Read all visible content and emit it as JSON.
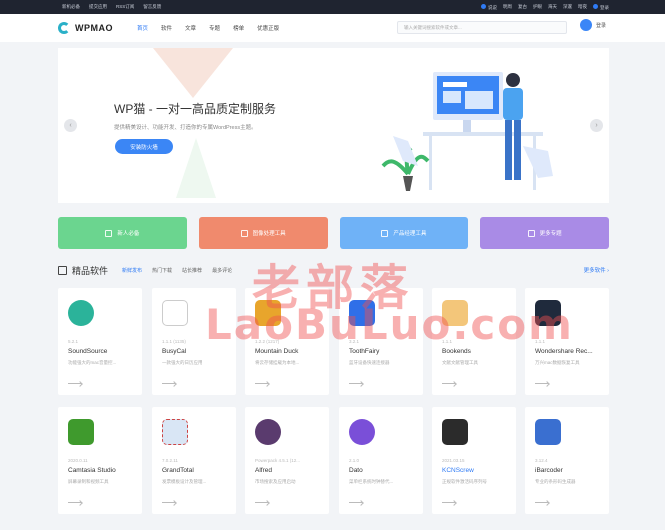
{
  "topbar": {
    "left_links": [
      "新机必备",
      "提交应用",
      "RSS订阅",
      "留言反馈"
    ],
    "right_links": [
      "说说",
      "明周",
      "复古",
      "护眼",
      "海天",
      "深邃",
      "暗夜",
      "登录"
    ]
  },
  "header": {
    "logo": "WPMAO",
    "nav": [
      "首页",
      "软件",
      "文章",
      "专题",
      "榜单",
      "优惠正版"
    ],
    "search_placeholder": "输入关键词搜索软件或文章...",
    "login": "登录"
  },
  "banner": {
    "title": "WP猫 - 一对一高品质定制服务",
    "subtitle": "提供精美设计、功能开发、打造你的专属WordPress主题。",
    "button": "安装防火墙",
    "prev": "‹",
    "next": "›"
  },
  "categories": [
    {
      "label": "新人必备",
      "color": "#6bd58f"
    },
    {
      "label": "图像处理工具",
      "color": "#f08a6d"
    },
    {
      "label": "产品经理工具",
      "color": "#6fb2f7"
    },
    {
      "label": "更多专题",
      "color": "#a98be6"
    }
  ],
  "section": {
    "title": "精品软件",
    "tabs": [
      "新鲜发布",
      "热门下载",
      "站长推荐",
      "最多评论"
    ],
    "more": "更多软件 ›"
  },
  "apps": [
    {
      "version": "5.2.1",
      "name": "SoundSource",
      "desc": "功能强大的mac音量控...",
      "icon_color": "#2bb39a"
    },
    {
      "version": "1.1.1 (1135)",
      "name": "BusyCal",
      "desc": "一款强大的日历应用",
      "icon_color": "#e8e8e8"
    },
    {
      "version": "1.2.2 (1217)",
      "name": "Mountain Duck",
      "desc": "将云存储挂载为本地...",
      "icon_color": "#e8a52c"
    },
    {
      "version": "3.2.1",
      "name": "ToothFairy",
      "desc": "蓝牙设备快速连接器",
      "icon_color": "#2f6fe8"
    },
    {
      "version": "1.1.1",
      "name": "Bookends",
      "desc": "文献文献管理工具",
      "icon_color": "#f3c67a"
    },
    {
      "version": "1.1.1",
      "name": "Wondershare Rec...",
      "desc": "万兴mac数据恢复工具",
      "icon_color": "#1f2a3c"
    },
    {
      "version": "2020.0.11",
      "name": "Camtasia Studio",
      "desc": "屏幕录制和视频工具",
      "icon_color": "#3f9a2d"
    },
    {
      "version": "7.0.2.11",
      "name": "GrandTotal",
      "desc": "发票模板设计及管理...",
      "icon_color": "#d9e6f5"
    },
    {
      "version": "Powerpack 4.5.1 (12...",
      "name": "Alfred",
      "desc": "市场搜索及应用启动",
      "icon_color": "#5a3b6e"
    },
    {
      "version": "2.1.0",
      "name": "Dato",
      "desc": "菜单栏系统时钟替代...",
      "icon_color": "#7a4fd8"
    },
    {
      "version": "2021.03.15",
      "name": "KCNScrew",
      "desc": "正规软件激活码序列号",
      "icon_color": "#2b2b2b"
    },
    {
      "version": "3.12.4",
      "name": "iBarcoder",
      "desc": "专业的条形码生成器",
      "icon_color": "#3a6fd0"
    }
  ],
  "watermark": {
    "line1": "老部落",
    "line2": "LaoBuLuo.com"
  }
}
